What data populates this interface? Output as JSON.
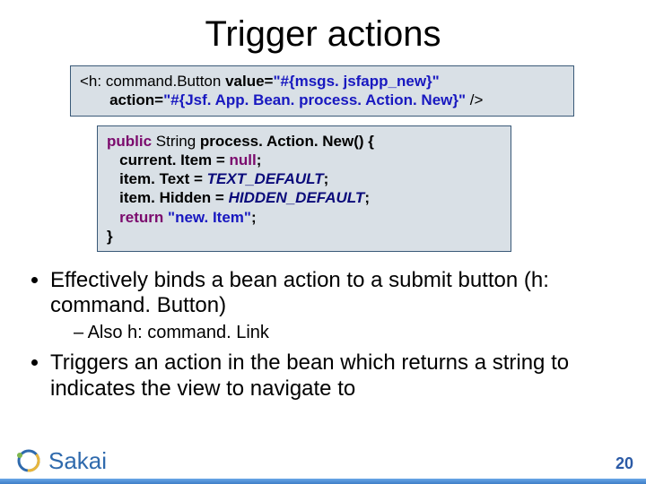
{
  "title": "Trigger actions",
  "code1": {
    "line1_a": "<h: command.Button ",
    "line1_b": "value=",
    "line1_c": "\"#{msgs. jsfapp_new}\"",
    "line2_a": "action=",
    "line2_b": "\"#{Jsf. App. Bean. process. Action. New}\"",
    "line2_c": " />"
  },
  "code2": {
    "l1_a": "public",
    "l1_b": " String ",
    "l1_c": "process. Action. New() {",
    "l2_a": "   current. Item = ",
    "l2_b": "null",
    "l2_c": ";",
    "l3_a": "   item. Text = ",
    "l3_b": "TEXT_DEFAULT",
    "l3_c": ";",
    "l4_a": "   item. Hidden = ",
    "l4_b": "HIDDEN_DEFAULT",
    "l4_c": ";",
    "l5_a": "   return",
    "l5_b": " \"new. Item\"",
    "l5_c": ";",
    "l6": "}"
  },
  "bullets": {
    "b1": "Effectively binds a bean action to a submit button (h: command. Button)",
    "b1_sub1": "Also h: command. Link",
    "b2": "Triggers an action in the bean which returns a string to indicates the view to navigate to"
  },
  "logo_text": "Sakai",
  "page_number": "20"
}
